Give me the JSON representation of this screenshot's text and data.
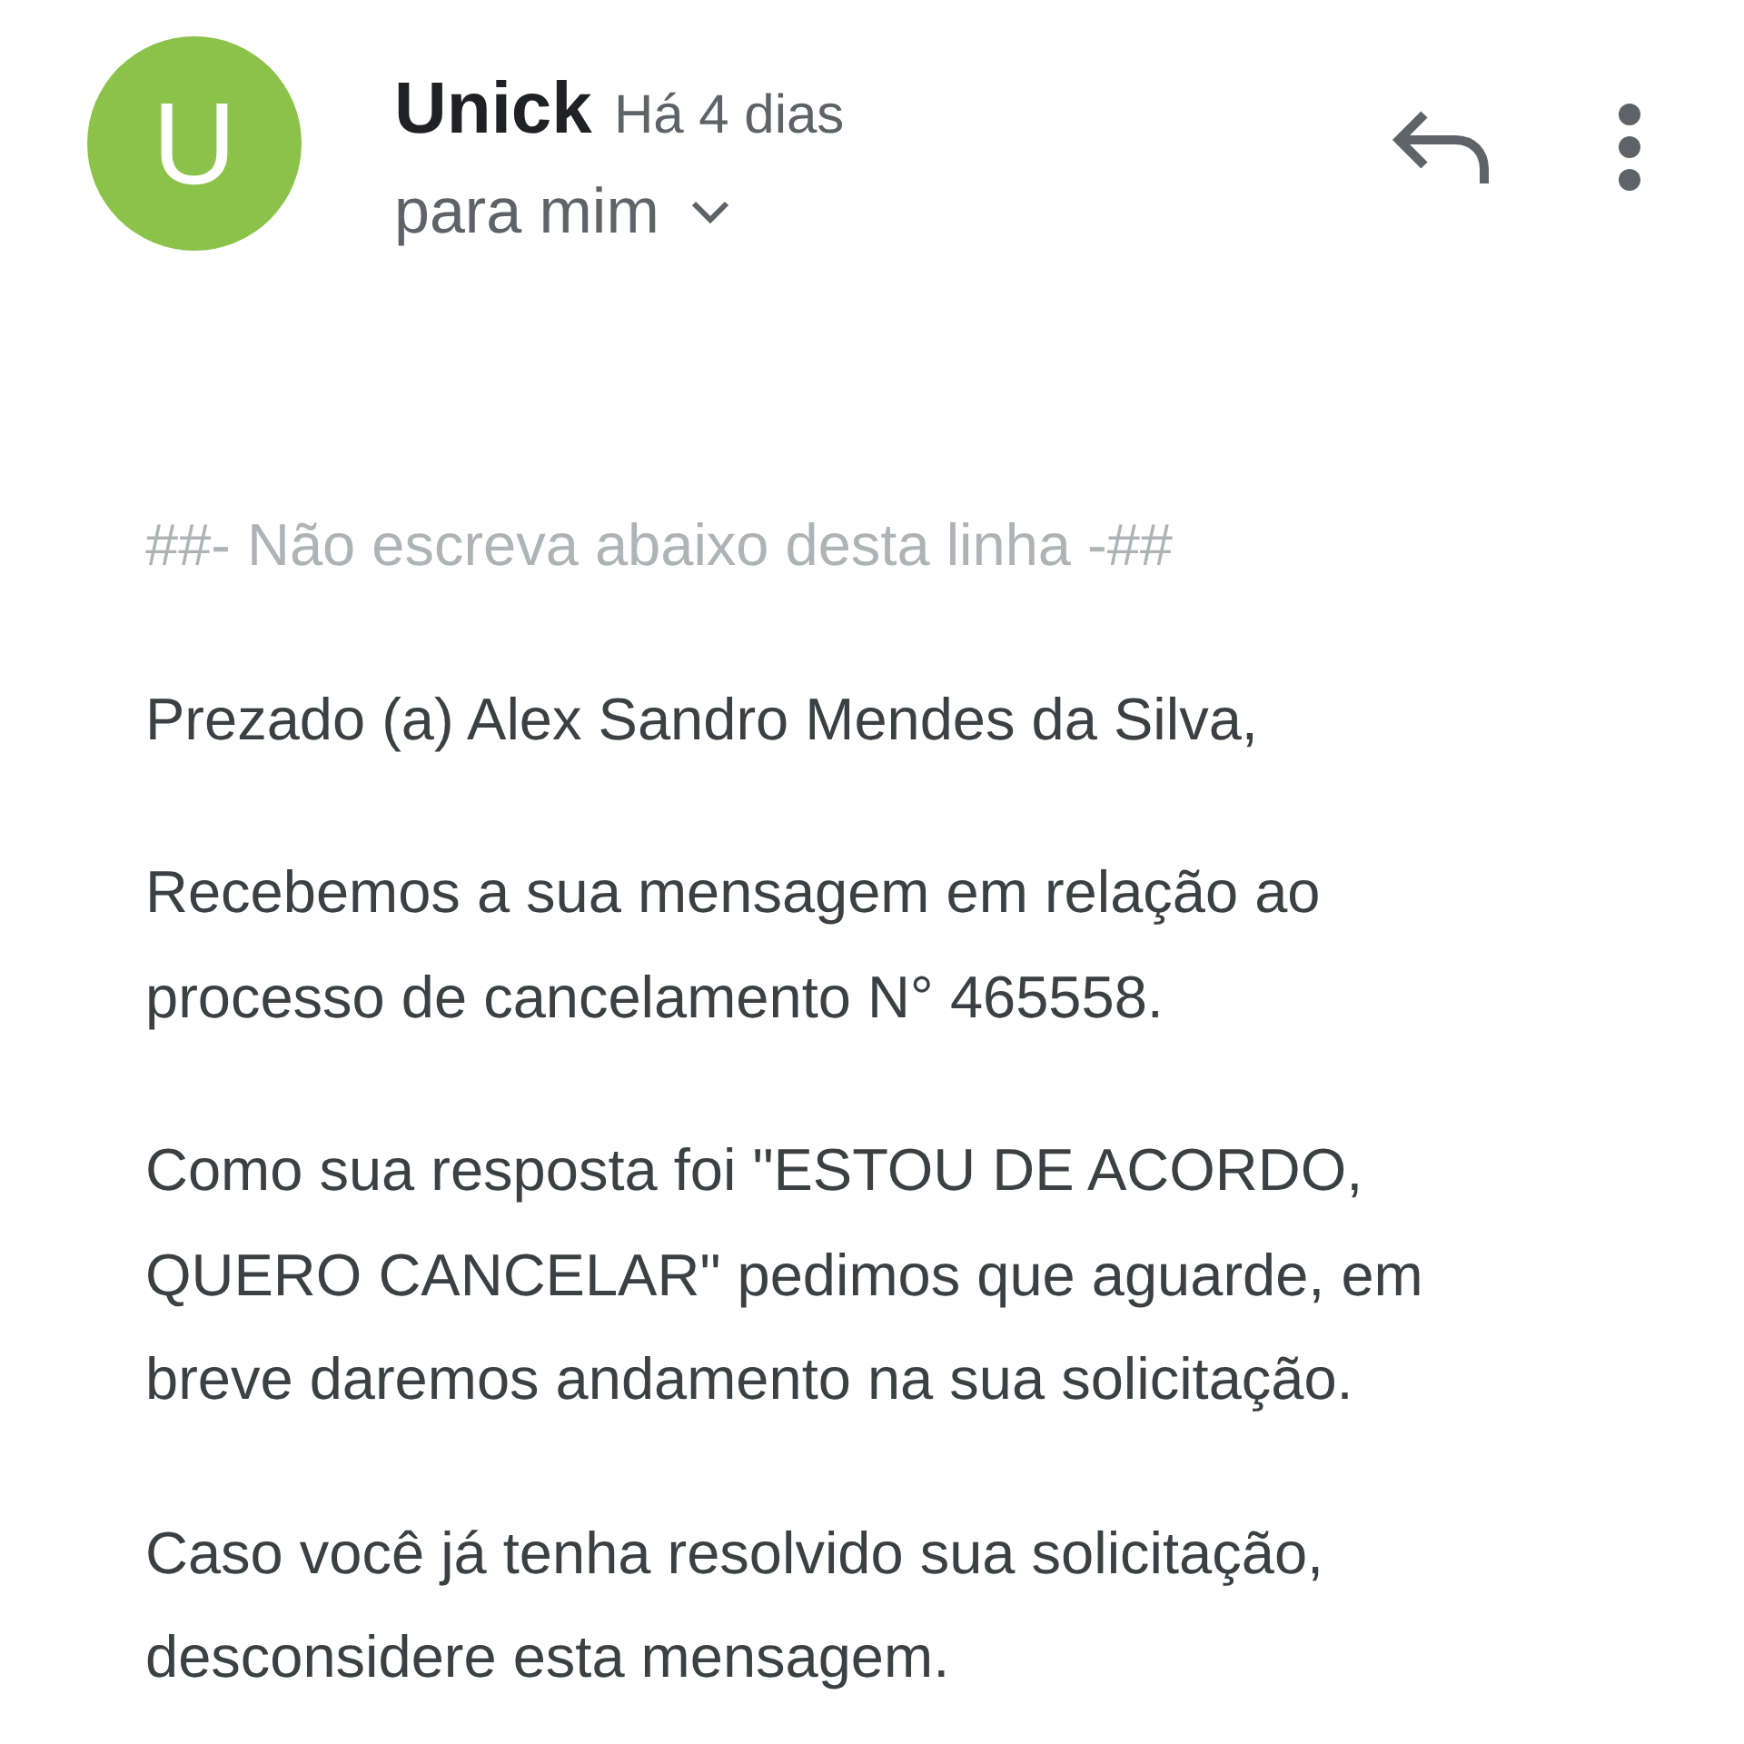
{
  "sender": {
    "avatar_letter": "U",
    "name": "Unick",
    "time": "Há 4 dias",
    "recipient": "para mim"
  },
  "body": {
    "separator": "##- Não escreva abaixo desta linha -##",
    "paragraphs": [
      "Prezado (a) Alex Sandro Mendes da Silva,",
      "Recebemos a sua mensagem em relação ao\nprocesso de cancelamento N° 465558.",
      "Como sua resposta foi \"ESTOU DE ACORDO,\nQUERO CANCELAR\" pedimos que aguarde, em\nbreve daremos andamento na sua solicitação.",
      "Caso você já tenha resolvido sua solicitação,\ndesconsidere esta mensagem."
    ]
  }
}
